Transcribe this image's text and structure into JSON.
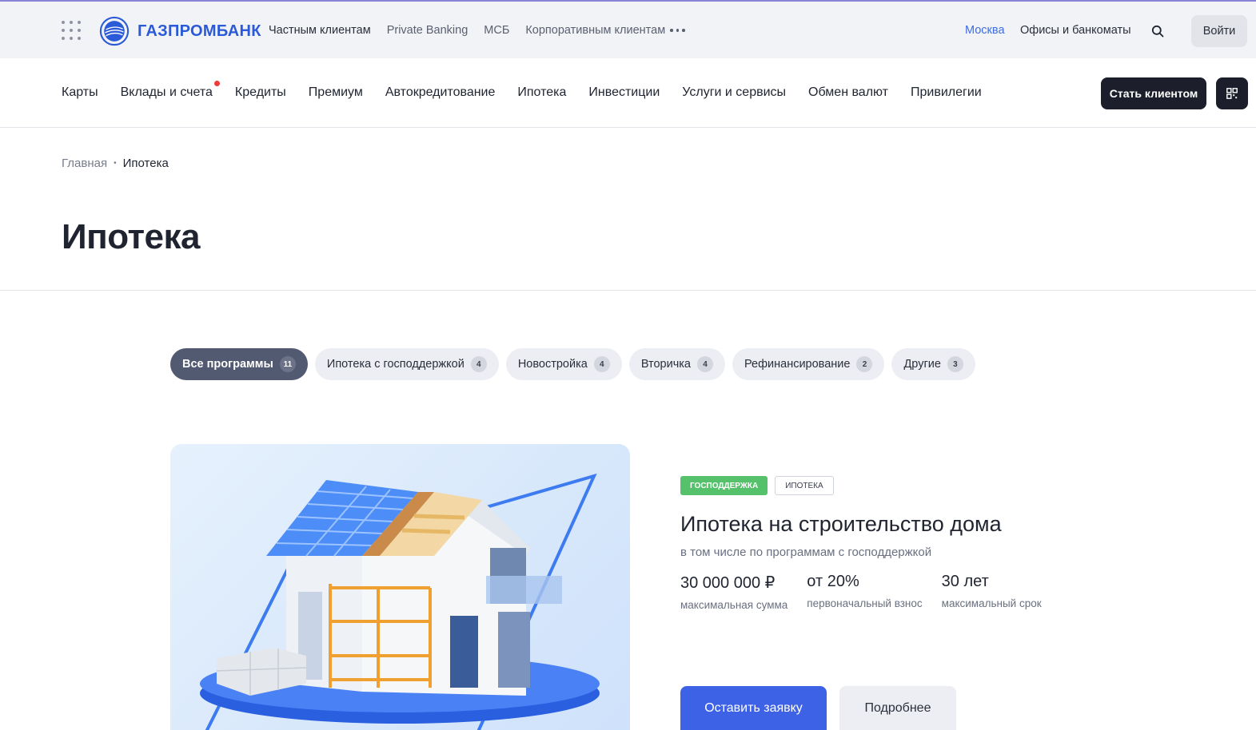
{
  "topbar": {
    "logo_text": "ГАЗПРОМБАНК",
    "links": [
      "Частным клиентам",
      "Private Banking",
      "МСБ",
      "Корпоративным клиентам"
    ],
    "city": "Москва",
    "offices": "Офисы и банкоматы",
    "login_label": "Войти",
    "city_color": "#3d6de0"
  },
  "mainnav": {
    "items": [
      "Карты",
      "Вклады и счета",
      "Кредиты",
      "Премиум",
      "Автокредитование",
      "Ипотека",
      "Инвестиции",
      "Услуги и сервисы",
      "Обмен валют",
      "Привилегии"
    ],
    "client_button": "Стать клиентом"
  },
  "breadcrumb": {
    "home": "Главная",
    "separator": "•",
    "current": "Ипотека"
  },
  "page_title": "Ипотека",
  "filters": [
    {
      "label": "Все программы",
      "count": "11",
      "active": true
    },
    {
      "label": "Ипотека с господдержкой",
      "count": "4",
      "active": false
    },
    {
      "label": "Новостройка",
      "count": "4",
      "active": false
    },
    {
      "label": "Вторичка",
      "count": "4",
      "active": false
    },
    {
      "label": "Рефинансирование",
      "count": "2",
      "active": false
    },
    {
      "label": "Другие",
      "count": "3",
      "active": false
    }
  ],
  "card": {
    "tags": [
      "ГОСПОДДЕРЖКА",
      "ИПОТЕКА"
    ],
    "title": "Ипотека на строительство дома",
    "subtitle": "в том числе по программам с господдержкой",
    "stats": [
      {
        "value": "30 000 000 ₽",
        "label": "максимальная сумма"
      },
      {
        "value": "от 20%",
        "label": "первоначальный взнос"
      },
      {
        "value": "30 лет",
        "label": "максимальный срок"
      }
    ],
    "apply_label": "Оставить заявку",
    "more_label": "Подробнее"
  },
  "colors": {
    "brand_blue": "#2b5ad8",
    "primary_button": "#3e62e6",
    "dark_button": "#1c1f2b",
    "tag_green": "#55c26b",
    "active_chip": "#525a72"
  }
}
